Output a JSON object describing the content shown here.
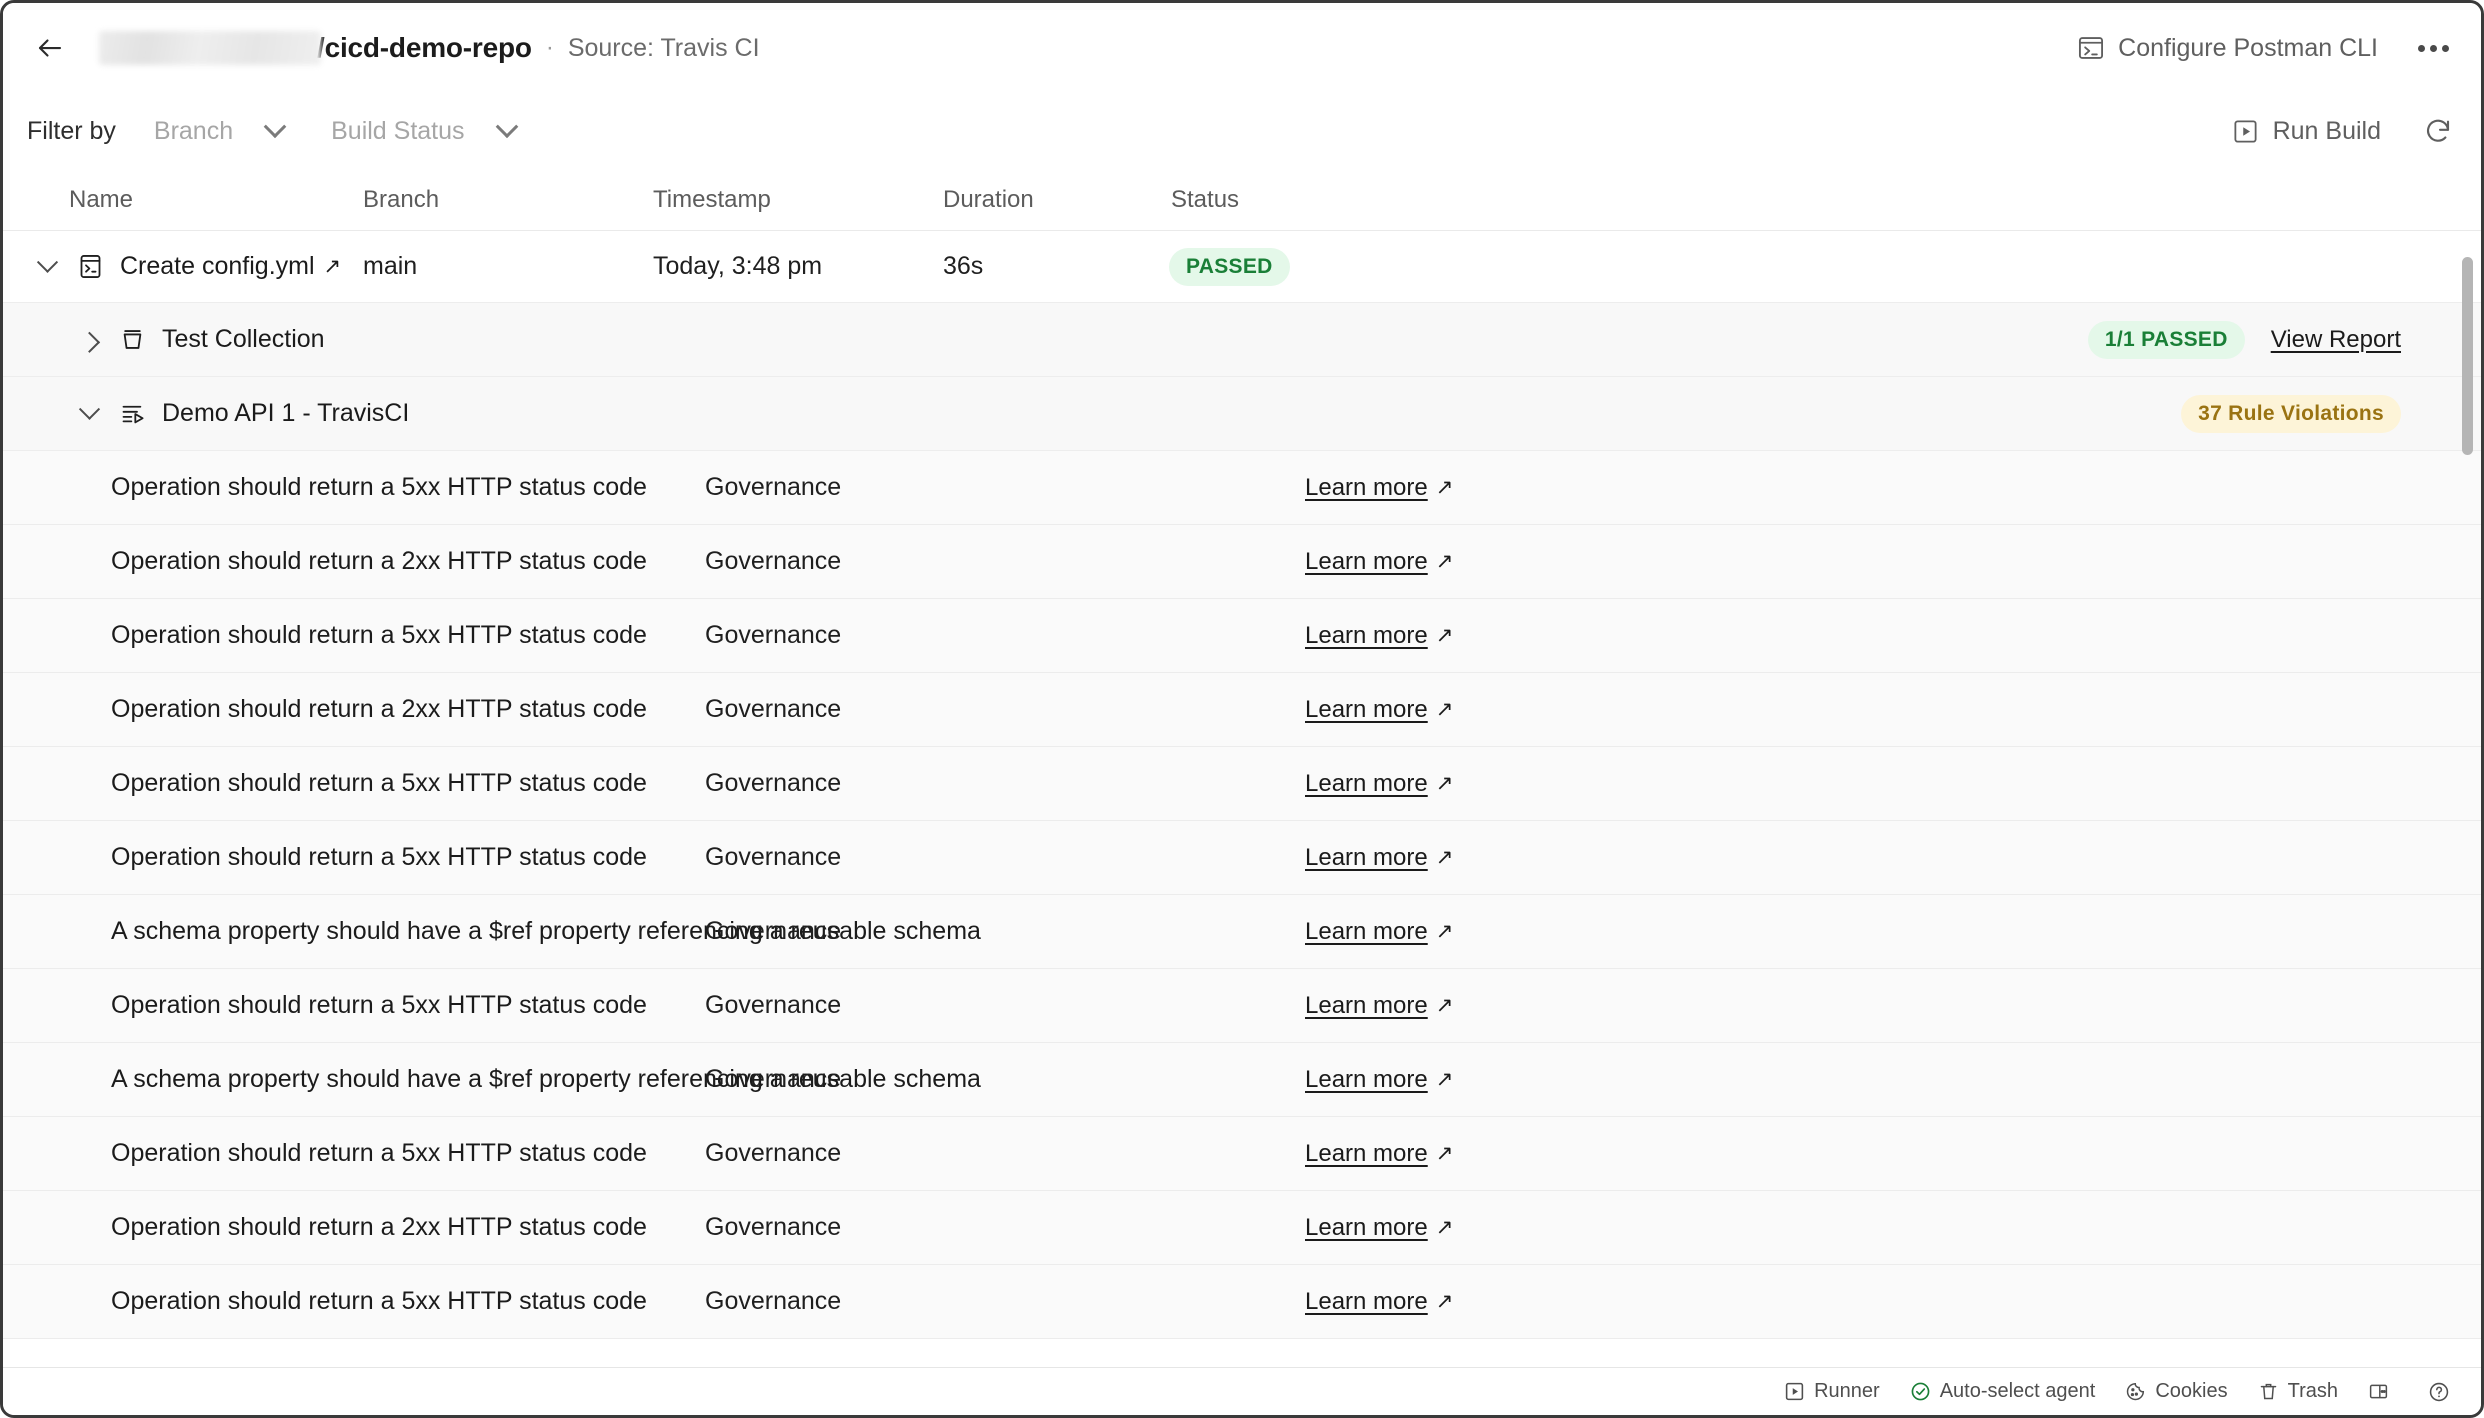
{
  "header": {
    "back_icon": "arrow-left-icon",
    "owner_redacted": "",
    "repo": "/cicd-demo-repo",
    "separator": "·",
    "source": "Source: Travis CI",
    "configure_cli_label": "Configure Postman CLI",
    "configure_cli_icon": "terminal-icon",
    "more_icon": "ellipsis-icon"
  },
  "filterbar": {
    "label": "Filter by",
    "branch": {
      "placeholder": "Branch",
      "icon": "chevron-down-icon"
    },
    "build_status": {
      "placeholder": "Build Status",
      "icon": "chevron-down-icon"
    },
    "run_build_label": "Run Build",
    "run_build_icon": "play-square-icon",
    "refresh_icon": "refresh-icon"
  },
  "table": {
    "columns": [
      "Name",
      "Branch",
      "Timestamp",
      "Duration",
      "Status"
    ],
    "build": {
      "name": "Create config.yml",
      "external_icon": "↗",
      "icon": "terminal-icon",
      "branch": "main",
      "timestamp": "Today, 3:48 pm",
      "duration": "36s",
      "status": "PASSED",
      "caret": "chevron-down-icon"
    },
    "children": [
      {
        "name": "Test Collection",
        "icon": "collection-icon",
        "caret": "chevron-right-icon",
        "badge": "1/1 PASSED",
        "badge_type": "pass",
        "link": "View Report"
      },
      {
        "name": "Demo API 1 - TravisCI",
        "icon": "api-spec-icon",
        "caret": "chevron-down-icon",
        "badge": "37 Rule Violations",
        "badge_type": "warn",
        "link": ""
      }
    ],
    "violation_link_label": "Learn more",
    "violation_link_arrow": "↗",
    "violations": [
      {
        "name": "Operation should return a 5xx HTTP status code",
        "category": "Governance"
      },
      {
        "name": "Operation should return a 2xx HTTP status code",
        "category": "Governance"
      },
      {
        "name": "Operation should return a 5xx HTTP status code",
        "category": "Governance"
      },
      {
        "name": "Operation should return a 2xx HTTP status code",
        "category": "Governance"
      },
      {
        "name": "Operation should return a 5xx HTTP status code",
        "category": "Governance"
      },
      {
        "name": "Operation should return a 5xx HTTP status code",
        "category": "Governance"
      },
      {
        "name": "A schema property should have a $ref property referencing a reusable schema",
        "category": "Governance"
      },
      {
        "name": "Operation should return a 5xx HTTP status code",
        "category": "Governance"
      },
      {
        "name": "A schema property should have a $ref property referencing a reusable schema",
        "category": "Governance"
      },
      {
        "name": "Operation should return a 5xx HTTP status code",
        "category": "Governance"
      },
      {
        "name": "Operation should return a 2xx HTTP status code",
        "category": "Governance"
      },
      {
        "name": "Operation should return a 5xx HTTP status code",
        "category": "Governance"
      }
    ]
  },
  "bottombar": {
    "items": [
      {
        "label": "Runner",
        "icon": "play-square-icon"
      },
      {
        "label": "Auto-select agent",
        "icon": "check-circle-icon"
      },
      {
        "label": "Cookies",
        "icon": "cookie-icon"
      },
      {
        "label": "Trash",
        "icon": "trash-icon"
      },
      {
        "label": "",
        "icon": "layout-panel-icon"
      },
      {
        "label": "",
        "icon": "help-circle-icon"
      }
    ]
  },
  "colors": {
    "pass_badge_bg": "#e4f8e9",
    "pass_badge_text": "#1a7f37",
    "warn_badge_bg": "#fdf4d8",
    "warn_badge_text": "#9a7312",
    "auto_select_green": "#1a7f37"
  }
}
